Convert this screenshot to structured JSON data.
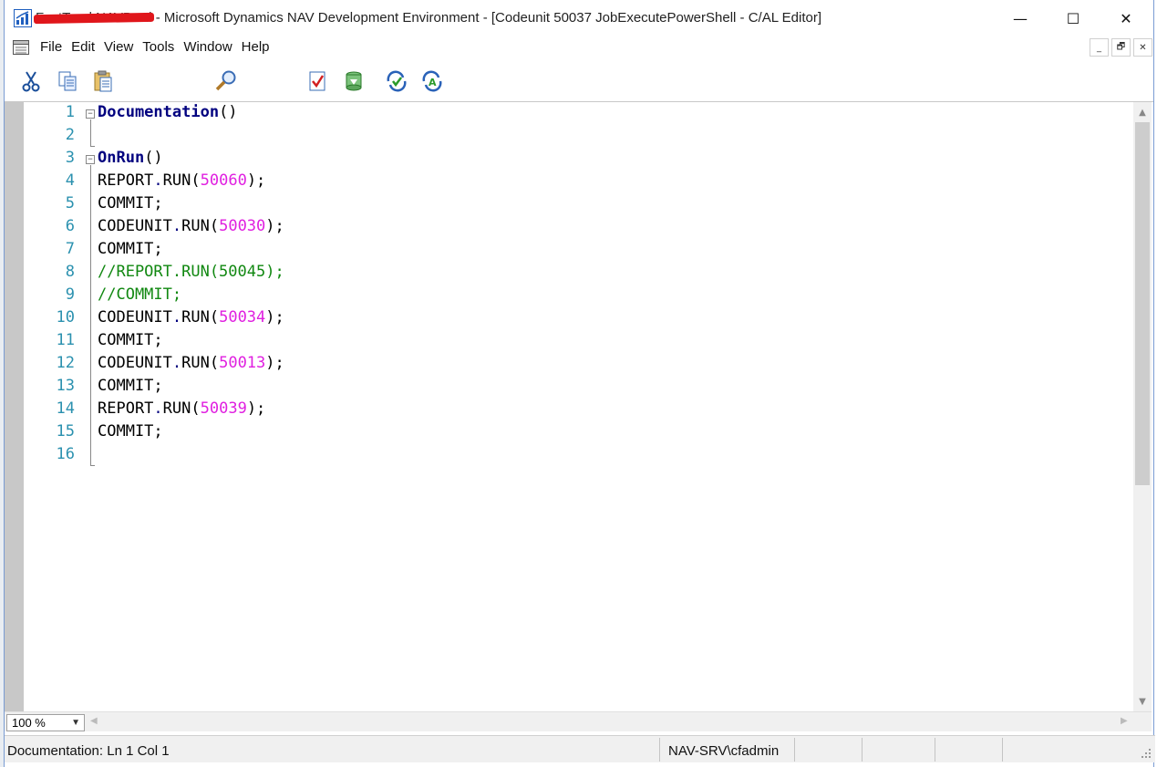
{
  "window": {
    "title_prefix": "FastTrackNAVProd",
    "title": " - Microsoft Dynamics NAV Development Environment - [Codeunit 50037 JobExecutePowerShell - C/AL Editor]",
    "minimize_glyph": "—",
    "maximize_glyph": "☐",
    "close_glyph": "✕"
  },
  "menu": {
    "items": [
      "File",
      "Edit",
      "View",
      "Tools",
      "Window",
      "Help"
    ]
  },
  "mdi_controls": {
    "minimize": "_",
    "restore": "🗗",
    "close": "✕"
  },
  "toolbar": {
    "buttons": [
      "cut-icon",
      "copy-icon",
      "paste-icon",
      "find-icon",
      "compile-icon",
      "save-icon",
      "run-icon",
      "debug-icon"
    ]
  },
  "editor": {
    "lines": [
      {
        "n": "1",
        "tokens": [
          {
            "t": "Documentation",
            "c": "decl"
          },
          {
            "t": "()",
            "c": "plain"
          }
        ]
      },
      {
        "n": "2",
        "tokens": []
      },
      {
        "n": "3",
        "tokens": [
          {
            "t": "OnRun",
            "c": "decl"
          },
          {
            "t": "()",
            "c": "plain"
          }
        ]
      },
      {
        "n": "4",
        "tokens": [
          {
            "t": "REPORT",
            "c": "plain"
          },
          {
            "t": ".",
            "c": "dot"
          },
          {
            "t": "RUN(",
            "c": "plain"
          },
          {
            "t": "50060",
            "c": "num"
          },
          {
            "t": ");",
            "c": "plain"
          }
        ]
      },
      {
        "n": "5",
        "tokens": [
          {
            "t": "COMMIT;",
            "c": "plain"
          }
        ]
      },
      {
        "n": "6",
        "tokens": [
          {
            "t": "CODEUNIT",
            "c": "plain"
          },
          {
            "t": ".",
            "c": "dot"
          },
          {
            "t": "RUN(",
            "c": "plain"
          },
          {
            "t": "50030",
            "c": "num"
          },
          {
            "t": ");",
            "c": "plain"
          }
        ]
      },
      {
        "n": "7",
        "tokens": [
          {
            "t": "COMMIT;",
            "c": "plain"
          }
        ]
      },
      {
        "n": "8",
        "tokens": [
          {
            "t": "//REPORT.RUN(50045);",
            "c": "comment"
          }
        ]
      },
      {
        "n": "9",
        "tokens": [
          {
            "t": "//COMMIT;",
            "c": "comment"
          }
        ]
      },
      {
        "n": "10",
        "tokens": [
          {
            "t": "CODEUNIT",
            "c": "plain"
          },
          {
            "t": ".",
            "c": "dot"
          },
          {
            "t": "RUN(",
            "c": "plain"
          },
          {
            "t": "50034",
            "c": "num"
          },
          {
            "t": ");",
            "c": "plain"
          }
        ]
      },
      {
        "n": "11",
        "tokens": [
          {
            "t": "COMMIT;",
            "c": "plain"
          }
        ]
      },
      {
        "n": "12",
        "tokens": [
          {
            "t": "CODEUNIT",
            "c": "plain"
          },
          {
            "t": ".",
            "c": "dot"
          },
          {
            "t": "RUN(",
            "c": "plain"
          },
          {
            "t": "50013",
            "c": "num"
          },
          {
            "t": ");",
            "c": "plain"
          }
        ]
      },
      {
        "n": "13",
        "tokens": [
          {
            "t": "COMMIT;",
            "c": "plain"
          }
        ]
      },
      {
        "n": "14",
        "tokens": [
          {
            "t": "REPORT",
            "c": "plain"
          },
          {
            "t": ".",
            "c": "dot"
          },
          {
            "t": "RUN(",
            "c": "plain"
          },
          {
            "t": "50039",
            "c": "num"
          },
          {
            "t": ");",
            "c": "plain"
          }
        ]
      },
      {
        "n": "15",
        "tokens": [
          {
            "t": "COMMIT;",
            "c": "plain"
          }
        ]
      },
      {
        "n": "16",
        "tokens": []
      }
    ],
    "colors": {
      "line_number": "#2b91af",
      "declaration": "#00007f",
      "number": "#e020e0",
      "comment": "#118811"
    }
  },
  "zoom": {
    "value": "100 %"
  },
  "status": {
    "position": "Documentation: Ln 1 Col 1",
    "user": "NAV-SRV\\cfadmin"
  }
}
